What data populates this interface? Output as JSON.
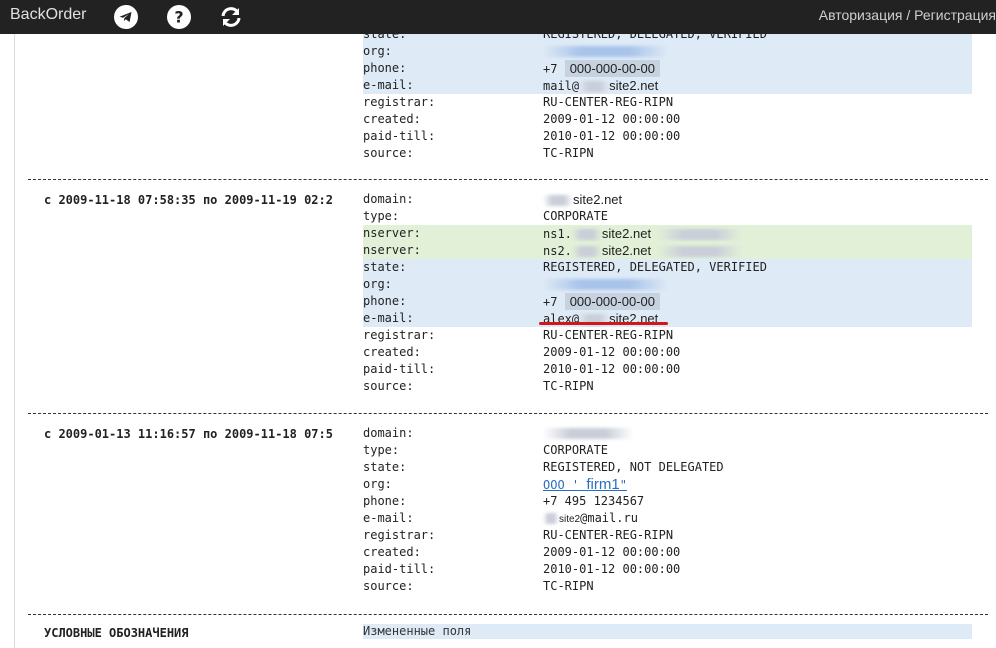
{
  "header": {
    "brand": "BackOrder",
    "auth_label": "Авторизация / Регистрация",
    "icons": [
      "telegram-icon",
      "help-icon",
      "refresh-icon"
    ]
  },
  "blocks": [
    {
      "period": "",
      "rows": [
        {
          "label": "state:",
          "value": "REGISTERED, DELEGATED, VERIFIED",
          "hl": "changed"
        },
        {
          "label": "org:",
          "value": "",
          "hl": "changed"
        },
        {
          "label": "phone:",
          "value": "+7",
          "mask": "000-000-00-00",
          "hl": "changed"
        },
        {
          "label": "e-mail:",
          "value": "mail@",
          "mask": "site2.net",
          "hl": "changed"
        },
        {
          "label": "registrar:",
          "value": "RU-CENTER-REG-RIPN",
          "hl": ""
        },
        {
          "label": "created:",
          "value": "2009-01-12 00:00:00",
          "hl": ""
        },
        {
          "label": "paid-till:",
          "value": "2010-01-12 00:00:00",
          "hl": ""
        },
        {
          "label": "source:",
          "value": "TC-RIPN",
          "hl": ""
        }
      ]
    },
    {
      "period": "с 2009-11-18 07:58:35 по 2009-11-19 02:2",
      "rows": [
        {
          "label": "domain:",
          "value": "",
          "mask": "site2.net",
          "hl": ""
        },
        {
          "label": "type:",
          "value": "CORPORATE",
          "hl": ""
        },
        {
          "label": "nserver:",
          "value": "ns1.",
          "mask": "site2.net",
          "hl": "added"
        },
        {
          "label": "nserver:",
          "value": "ns2.",
          "mask": "site2.net",
          "hl": "added"
        },
        {
          "label": "state:",
          "value": "REGISTERED, DELEGATED, VERIFIED",
          "hl": "changed"
        },
        {
          "label": "org:",
          "value": "",
          "hl": "changed"
        },
        {
          "label": "phone:",
          "value": "+7",
          "mask": "000-000-00-00",
          "hl": "changed"
        },
        {
          "label": "e-mail:",
          "value": "alex@",
          "mask": "site2.net",
          "hl": "changed"
        },
        {
          "label": "registrar:",
          "value": "RU-CENTER-REG-RIPN",
          "hl": ""
        },
        {
          "label": "created:",
          "value": "2009-01-12 00:00:00",
          "hl": ""
        },
        {
          "label": "paid-till:",
          "value": "2010-01-12 00:00:00",
          "hl": ""
        },
        {
          "label": "source:",
          "value": "TC-RIPN",
          "hl": ""
        }
      ]
    },
    {
      "period": "с 2009-01-13 11:16:57 по 2009-11-18 07:5",
      "rows": [
        {
          "label": "domain:",
          "value": "",
          "hl": ""
        },
        {
          "label": "type:",
          "value": "CORPORATE",
          "hl": ""
        },
        {
          "label": "state:",
          "value": "REGISTERED, NOT DELEGATED",
          "hl": ""
        },
        {
          "label": "org:",
          "value": "ООО '",
          "mask": "firm1",
          "suffix": "\"",
          "hl": ""
        },
        {
          "label": "phone:",
          "value": "+7 495 1234567",
          "hl": ""
        },
        {
          "label": "e-mail:",
          "value": "",
          "mask": "site2",
          "suffix": "@mail.ru",
          "hl": ""
        },
        {
          "label": "registrar:",
          "value": "RU-CENTER-REG-RIPN",
          "hl": ""
        },
        {
          "label": "created:",
          "value": "2009-01-12 00:00:00",
          "hl": ""
        },
        {
          "label": "paid-till:",
          "value": "2010-01-12 00:00:00",
          "hl": ""
        },
        {
          "label": "source:",
          "value": "TC-RIPN",
          "hl": ""
        }
      ]
    }
  ],
  "legend": {
    "title": "УСЛОВНЫЕ ОБОЗНАЧЕНИЯ",
    "changed_fields": "Измененные поля"
  },
  "colors": {
    "topbar": "#222222",
    "changed": "#deeaf6",
    "added": "#e2f0d8",
    "underline": "#d01818",
    "link": "#2a6fbf"
  }
}
